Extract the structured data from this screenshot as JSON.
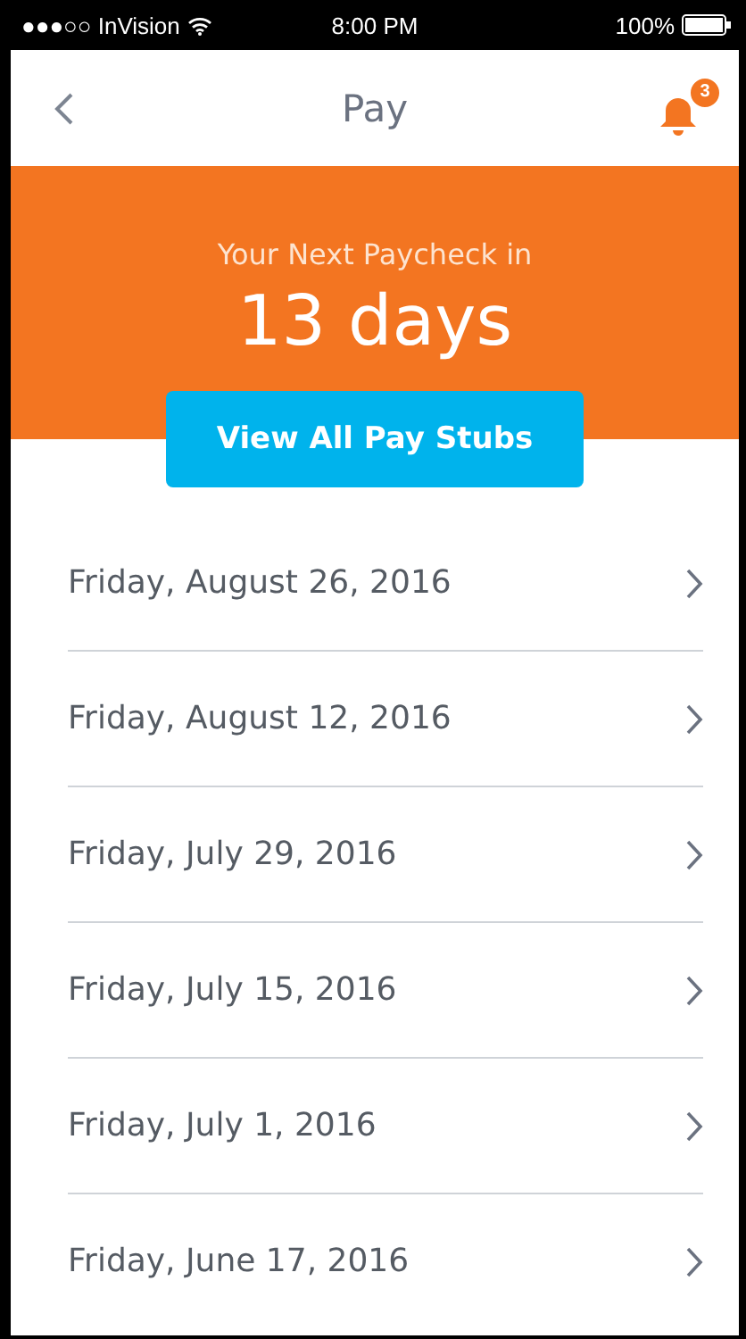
{
  "status_bar": {
    "carrier": "●●●○○ InVision",
    "time": "8:00 PM",
    "battery": "100%"
  },
  "nav": {
    "title": "Pay",
    "badge": "3"
  },
  "hero": {
    "subtitle": "Your Next Paycheck in",
    "headline": "13 days",
    "button": "View All Pay Stubs"
  },
  "pay_dates": [
    {
      "label": "Friday, August 26, 2016"
    },
    {
      "label": "Friday, August 12, 2016"
    },
    {
      "label": "Friday, July 29, 2016"
    },
    {
      "label": "Friday, July 15, 2016"
    },
    {
      "label": "Friday, July 1, 2016"
    },
    {
      "label": "Friday, June 17, 2016"
    }
  ]
}
